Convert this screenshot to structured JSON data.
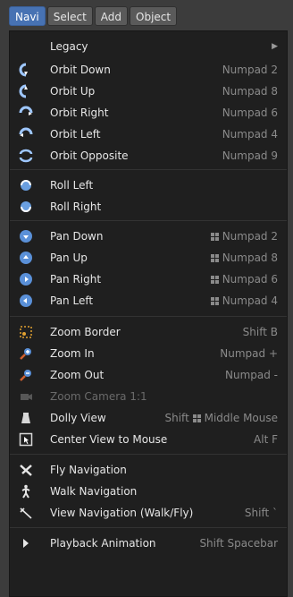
{
  "tabs": [
    "Navi",
    "Select",
    "Add",
    "Object"
  ],
  "menu": {
    "legacy": "Legacy",
    "orbit_down": {
      "label": "Orbit Down",
      "shortcut": "Numpad 2"
    },
    "orbit_up": {
      "label": "Orbit Up",
      "shortcut": "Numpad 8"
    },
    "orbit_right": {
      "label": "Orbit Right",
      "shortcut": "Numpad 6"
    },
    "orbit_left": {
      "label": "Orbit Left",
      "shortcut": "Numpad 4"
    },
    "orbit_opposite": {
      "label": "Orbit Opposite",
      "shortcut": "Numpad 9"
    },
    "roll_left": {
      "label": "Roll Left"
    },
    "roll_right": {
      "label": "Roll Right"
    },
    "pan_down": {
      "label": "Pan Down",
      "shortcut": "Numpad 2"
    },
    "pan_up": {
      "label": "Pan Up",
      "shortcut": "Numpad 8"
    },
    "pan_right": {
      "label": "Pan Right",
      "shortcut": "Numpad 6"
    },
    "pan_left": {
      "label": "Pan Left",
      "shortcut": "Numpad 4"
    },
    "zoom_border": {
      "label": "Zoom Border",
      "shortcut": "Shift B"
    },
    "zoom_in": {
      "label": "Zoom In",
      "shortcut": "Numpad +"
    },
    "zoom_out": {
      "label": "Zoom Out",
      "shortcut": "Numpad -"
    },
    "zoom_camera": {
      "label": "Zoom Camera 1:1",
      "shortcut": ""
    },
    "dolly_view": {
      "label": "Dolly View",
      "shortcut_prefix": "Shift",
      "shortcut": "Middle Mouse"
    },
    "center_view": {
      "label": "Center View to Mouse",
      "shortcut": "Alt F"
    },
    "fly_navigation": {
      "label": "Fly Navigation"
    },
    "walk_navigation": {
      "label": "Walk Navigation"
    },
    "view_navigation": {
      "label": "View Navigation (Walk/Fly)",
      "shortcut": "Shift `"
    },
    "playback_animation": {
      "label": "Playback Animation",
      "shortcut": "Shift Spacebar"
    }
  }
}
